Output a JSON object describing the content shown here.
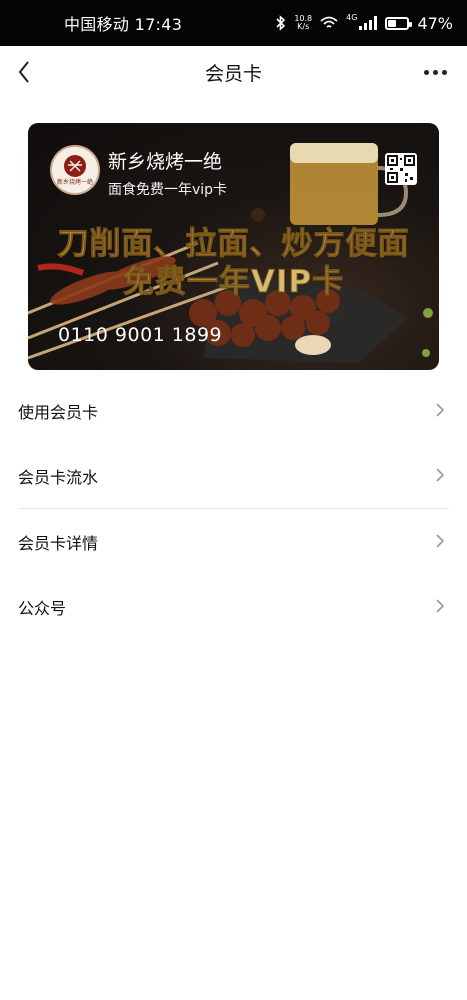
{
  "status_bar": {
    "carrier_time": "中国移动 17:43",
    "net_speed_value": "10.8",
    "net_speed_unit": "K/s",
    "network_tag": "4G",
    "battery_percent": "47%",
    "battery_level": 0.47,
    "icons": [
      "bluetooth-icon",
      "wifi-icon",
      "signal-icon",
      "battery-icon"
    ]
  },
  "nav": {
    "title": "会员卡",
    "back_icon": "chevron-left-icon",
    "more_icon": "more-dots-icon"
  },
  "card": {
    "logo_text": "新乡烧烤一绝",
    "shop_name": "新乡烧烤一绝",
    "subtitle": "面食免费一年vip卡",
    "promo_line1": "刀削面、拉面、炒方便面",
    "promo_line2": "免费一年VIP卡",
    "card_number": "0110 9001 1899",
    "qr_icon": "qr-code-icon"
  },
  "menu": {
    "items": [
      {
        "label": "使用会员卡"
      },
      {
        "label": "会员卡流水"
      },
      {
        "label": "会员卡详情"
      },
      {
        "label": "公众号"
      }
    ],
    "chevron_icon": "chevron-right-icon"
  }
}
